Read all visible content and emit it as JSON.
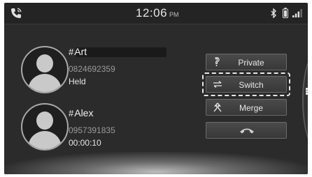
{
  "status_bar": {
    "time": "12:06",
    "ampm": "PM",
    "left_icon": "phone-call-icon",
    "right_icons": [
      "bluetooth-icon",
      "battery-icon",
      "signal-icon"
    ]
  },
  "calls": [
    {
      "name": "Art",
      "number": "0824692359",
      "status": "Held"
    },
    {
      "name": "Alex",
      "number": "0957391835",
      "status": "00:00:10"
    }
  ],
  "name_prefix": "#",
  "actions": {
    "private_label": "Private",
    "switch_label": "Switch",
    "merge_label": "Merge",
    "end_icon": "hang-up-icon"
  },
  "colors": {
    "background": "#2b2b2b",
    "button": "#404040",
    "text": "#e8e8e8",
    "secondary_text": "#9a9a9a"
  }
}
